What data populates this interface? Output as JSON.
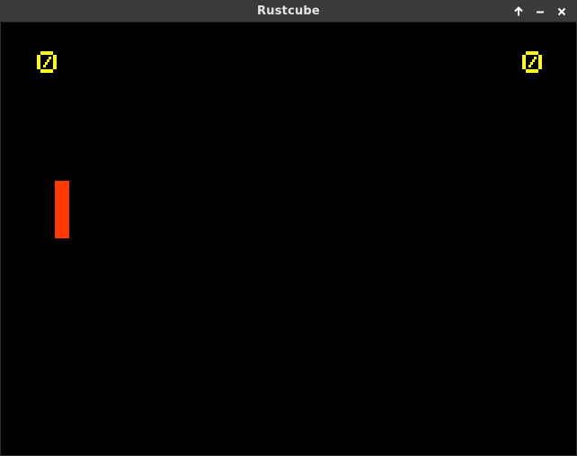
{
  "window": {
    "title": "Rustcube",
    "controls": {
      "maximize_icon": "arrow-up-icon",
      "minimize_icon": "minus-icon",
      "close_icon": "close-icon"
    }
  },
  "game": {
    "background_color": "#000000",
    "score_color": "#ffff00",
    "paddle_color": "#ff3a00",
    "score_left": "0",
    "score_right": "0"
  }
}
